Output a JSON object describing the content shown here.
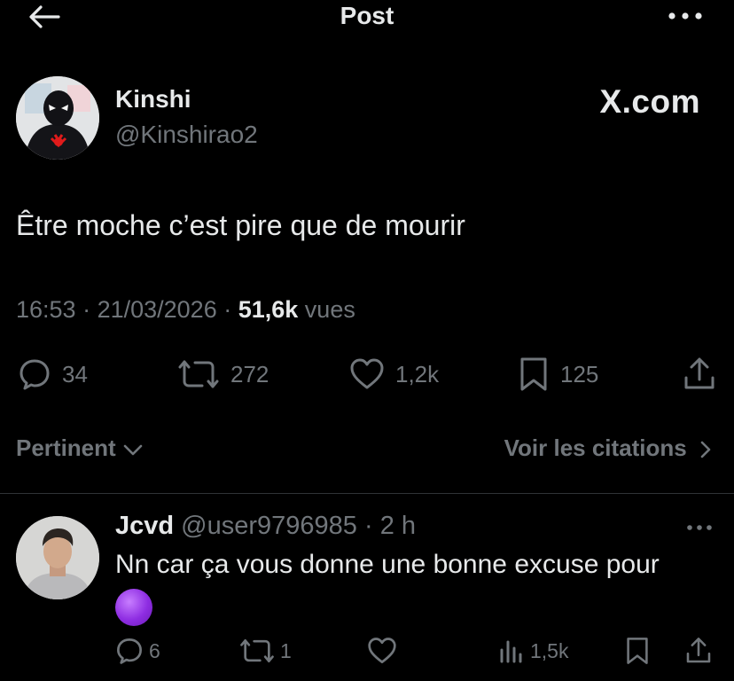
{
  "header": {
    "title": "Post",
    "back_icon": "arrow-left-icon",
    "more_icon": "more-horizontal-icon"
  },
  "tweet": {
    "author_name": "Kinshi",
    "author_handle": "@Kinshirao2",
    "watermark": "X.com",
    "text": "Être moche c’est pire que de mourir",
    "time": "16:53",
    "sep1": " · ",
    "date": "21/03/2026",
    "sep2": " · ",
    "views": "51,6k",
    "views_label": " vues",
    "stats": {
      "replies": "34",
      "reposts": "272",
      "likes": "1,2k",
      "bookmarks": "125"
    }
  },
  "replies_sort": {
    "label": "Pertinent",
    "quotes_link": "Voir les citations"
  },
  "reply": {
    "name": "Jcvd",
    "handle": "@user9796985",
    "sep": " · ",
    "time": "2 h",
    "text": "Nn car ça vous donne une bonne excuse pour",
    "emoji": "purple-circle",
    "stats": {
      "replies": "6",
      "reposts": "1",
      "views": "1,5k"
    }
  },
  "colors": {
    "background": "#000000",
    "text": "#e7e9ea",
    "muted": "#71767b",
    "divider": "#2f3336",
    "emoji": "#8e2de2"
  }
}
